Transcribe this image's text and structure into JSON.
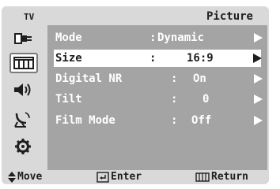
{
  "header": {
    "source": "TV",
    "title": "Picture"
  },
  "sidebar": {
    "icons": [
      {
        "name": "input-icon",
        "selected": false
      },
      {
        "name": "picture-icon",
        "selected": true
      },
      {
        "name": "sound-icon",
        "selected": false
      },
      {
        "name": "channel-icon",
        "selected": false
      },
      {
        "name": "setup-icon",
        "selected": false
      }
    ]
  },
  "menu": {
    "items": [
      {
        "label": "Mode",
        "separator": ":",
        "value": "Dynamic",
        "selected": false
      },
      {
        "label": "Size",
        "separator": ":",
        "value": "16:9",
        "selected": true
      },
      {
        "label": "Digital NR",
        "separator": ":",
        "value": "On",
        "selected": false
      },
      {
        "label": "Tilt",
        "separator": ":",
        "value": "0",
        "selected": false
      },
      {
        "label": "Film Mode",
        "separator": ":",
        "value": "Off",
        "selected": false
      }
    ]
  },
  "footer": {
    "move": "Move",
    "enter": "Enter",
    "return": "Return"
  },
  "colors": {
    "panel": "#a4a4a4",
    "bar": "#d9d9d9",
    "highlight": "#ffffff",
    "text_dark": "#1e1e1e",
    "text_light": "#ffffff"
  }
}
